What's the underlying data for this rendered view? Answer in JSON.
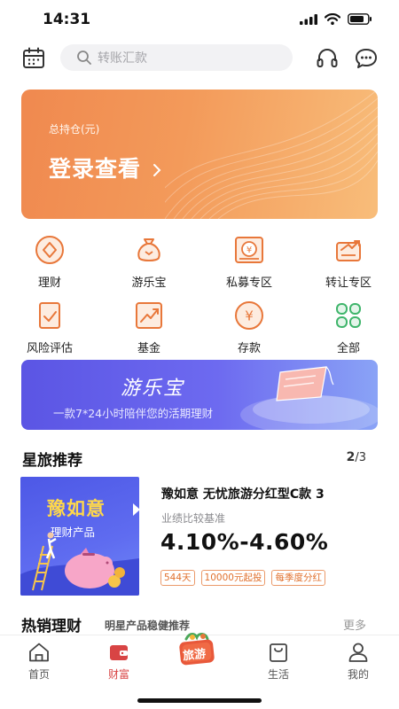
{
  "status_bar": {
    "time": "14:31"
  },
  "header": {
    "search_placeholder": "转账汇款"
  },
  "banner": {
    "label": "总持仓(元)",
    "cta": "登录查看"
  },
  "services": [
    {
      "label": "理财",
      "icon": "wealth-icon"
    },
    {
      "label": "游乐宝",
      "icon": "money-bag-icon"
    },
    {
      "label": "私募专区",
      "icon": "private-fund-icon"
    },
    {
      "label": "转让专区",
      "icon": "transfer-icon"
    },
    {
      "label": "风险评估",
      "icon": "risk-assessment-icon"
    },
    {
      "label": "基金",
      "icon": "fund-chart-icon"
    },
    {
      "label": "存款",
      "icon": "deposit-icon"
    },
    {
      "label": "全部",
      "icon": "all-grid-icon"
    }
  ],
  "promo": {
    "brand": "游乐宝",
    "slogan": "一款7*24小时陪伴您的活期理财"
  },
  "recommend": {
    "title": "星旅推荐",
    "page_current": "2",
    "page_total": "/3",
    "card_title": "豫如意",
    "card_subtitle": "理财产品",
    "product_name": "豫如意 无忧旅游分红型C款 3",
    "rate_label": "业绩比较基准",
    "rate": "4.10%-4.60%",
    "tags": [
      "544天",
      "10000元起投",
      "每季度分红"
    ]
  },
  "hot": {
    "title": "热销理财",
    "subtitle": "明星产品稳健推荐",
    "more": "更多"
  },
  "tabbar": {
    "tabs": [
      {
        "label": "首页",
        "icon": "home-icon"
      },
      {
        "label": "财富",
        "icon": "wallet-icon"
      },
      {
        "label": "旅游",
        "icon": "travel-icon"
      },
      {
        "label": "生活",
        "icon": "shopping-bag-icon"
      },
      {
        "label": "我的",
        "icon": "profile-icon"
      }
    ],
    "active": "财富"
  },
  "colors": {
    "accent": "#e8773a",
    "active_tab": "#d84444",
    "promo": "#5b55e4"
  }
}
